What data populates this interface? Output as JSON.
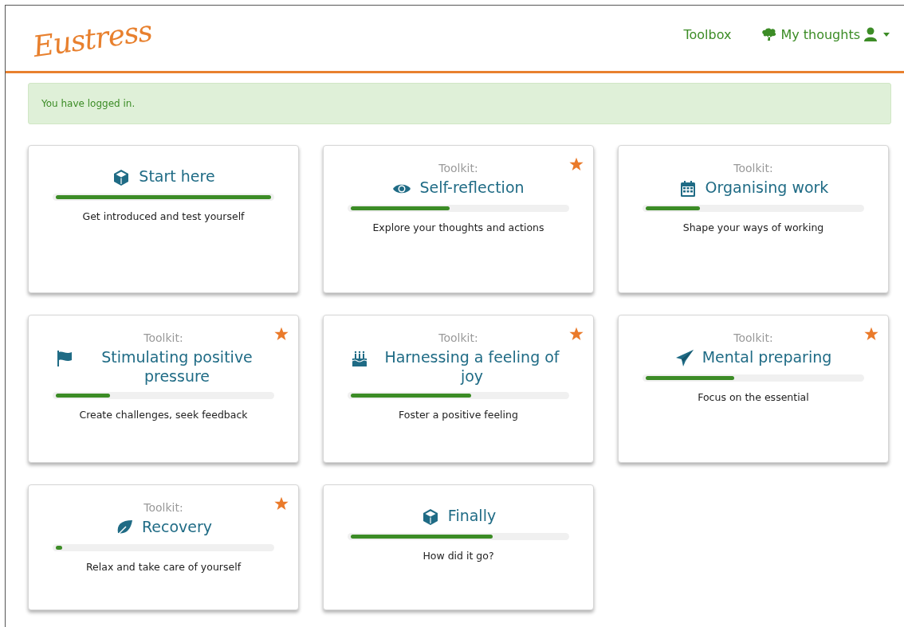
{
  "brand": {
    "logo": "Eustress"
  },
  "nav": [
    {
      "label": "Toolbox",
      "kind": "link"
    },
    {
      "label": "My thoughts",
      "kind": "menu"
    }
  ],
  "alert": {
    "text": "You have logged in."
  },
  "cards": [
    {
      "kind": "cube",
      "title": "Start here",
      "level": 1.0,
      "description": "Get introduced and test yourself",
      "starred": false
    },
    {
      "kind": "eye",
      "label": "Toolkit:",
      "title": "Self-reflection",
      "level": 0.46,
      "description": "Explore your thoughts and actions",
      "starred": true
    },
    {
      "kind": "calendar",
      "label": "Toolkit:",
      "title": "Organising work",
      "level": 0.25,
      "description": "Shape your ways of working",
      "starred": false
    },
    {
      "kind": "flag",
      "label": "Toolkit:",
      "title": "Stimulating positive pressure",
      "level": 0.25,
      "description": "Create challenges, seek feedback",
      "starred": true
    },
    {
      "kind": "cake",
      "label": "Toolkit:",
      "title": "Harnessing a feeling of joy",
      "level": 0.56,
      "description": "Foster a positive feeling",
      "starred": true
    },
    {
      "kind": "plane",
      "label": "Toolkit:",
      "title": "Mental preparing",
      "level": 0.41,
      "description": "Focus on the essential",
      "starred": true
    },
    {
      "kind": "leaf",
      "label": "Toolkit:",
      "title": "Recovery",
      "level": 0.03,
      "description": "Relax and take care of yourself",
      "starred": true
    },
    {
      "kind": "cube",
      "title": "Finally",
      "level": 0.66,
      "description": "How did it go?",
      "starred": false
    }
  ]
}
